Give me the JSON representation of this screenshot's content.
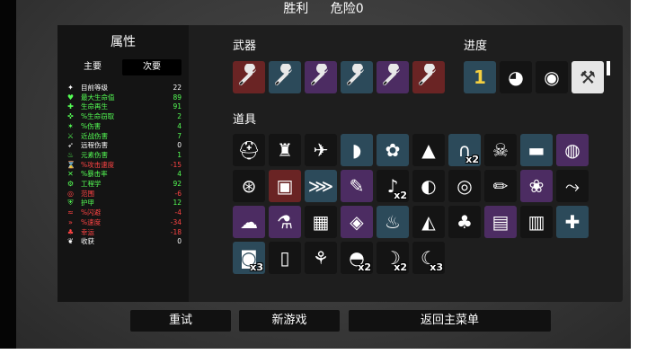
{
  "header": {
    "result": "胜利",
    "danger": "危险0"
  },
  "stats": {
    "title": "属性",
    "tab_primary": "主要",
    "tab_secondary": "次要",
    "rows": [
      {
        "icon": "level-icon",
        "glyph": "✦",
        "label": "目前等级",
        "value": "22",
        "color": "#ffffff"
      },
      {
        "icon": "max-hp-icon",
        "glyph": "♥",
        "label": "最大生命值",
        "value": "89",
        "color": "#55ff55"
      },
      {
        "icon": "hp-regen-icon",
        "glyph": "✚",
        "label": "生命再生",
        "value": "91",
        "color": "#55ff55"
      },
      {
        "icon": "life-steal-icon",
        "glyph": "✜",
        "label": "%生命窃取",
        "value": "2",
        "color": "#55ff55"
      },
      {
        "icon": "damage-icon",
        "glyph": "✶",
        "label": "%伤害",
        "value": "4",
        "color": "#55ff55"
      },
      {
        "icon": "melee-damage-icon",
        "glyph": "⚔",
        "label": "近战伤害",
        "value": "7",
        "color": "#55ff55"
      },
      {
        "icon": "ranged-damage-icon",
        "glyph": "➶",
        "label": "远程伤害",
        "value": "0",
        "color": "#ffffff"
      },
      {
        "icon": "elemental-damage-icon",
        "glyph": "♨",
        "label": "元素伤害",
        "value": "1",
        "color": "#55ff55"
      },
      {
        "icon": "attack-speed-icon",
        "glyph": "⌛",
        "label": "%攻击速度",
        "value": "-15",
        "color": "#ff4444"
      },
      {
        "icon": "crit-chance-icon",
        "glyph": "✕",
        "label": "%暴击率",
        "value": "4",
        "color": "#55ff55"
      },
      {
        "icon": "engineering-icon",
        "glyph": "⚙",
        "label": "工程学",
        "value": "92",
        "color": "#55ff55"
      },
      {
        "icon": "range-icon",
        "glyph": "◎",
        "label": "范围",
        "value": "-6",
        "color": "#ff4444"
      },
      {
        "icon": "armor-icon",
        "glyph": "⛨",
        "label": "护甲",
        "value": "12",
        "color": "#55ff55"
      },
      {
        "icon": "dodge-icon",
        "glyph": "≈",
        "label": "%闪避",
        "value": "-4",
        "color": "#ff4444"
      },
      {
        "icon": "speed-icon",
        "glyph": "»",
        "label": "%速度",
        "value": "-34",
        "color": "#ff4444"
      },
      {
        "icon": "luck-icon",
        "glyph": "♣",
        "label": "幸运",
        "value": "-18",
        "color": "#ff4444"
      },
      {
        "icon": "harvesting-icon",
        "glyph": "❦",
        "label": "收获",
        "value": "0",
        "color": "#ffffff"
      }
    ]
  },
  "weapons": {
    "label": "武器",
    "items": [
      {
        "icon": "wrench-icon",
        "tier": "red"
      },
      {
        "icon": "wrench-icon",
        "tier": "blue"
      },
      {
        "icon": "wrench-icon",
        "tier": "purple"
      },
      {
        "icon": "wrench-icon",
        "tier": "blue"
      },
      {
        "icon": "wrench-icon",
        "tier": "purple"
      },
      {
        "icon": "wrench-icon",
        "tier": "red"
      }
    ]
  },
  "progress": {
    "label": "进度",
    "items": [
      {
        "icon": "number-one-icon",
        "glyph": "1",
        "tier": "blue"
      },
      {
        "icon": "smug-egg-icon",
        "glyph": "◕",
        "tier": "normal"
      },
      {
        "icon": "masked-egg-icon",
        "glyph": "◉",
        "tier": "normal"
      },
      {
        "icon": "screwdriver-icon",
        "glyph": "⚒",
        "tier": "white"
      }
    ]
  },
  "items": {
    "label": "道具",
    "rows": [
      [
        {
          "icon": "helmet-icon",
          "glyph": "⛑",
          "tier": "normal",
          "count": ""
        },
        {
          "icon": "robot-icon",
          "glyph": "♜",
          "tier": "normal",
          "count": ""
        },
        {
          "icon": "tank-icon",
          "glyph": "✈",
          "tier": "normal",
          "count": ""
        },
        {
          "icon": "horn-icon",
          "glyph": "◗",
          "tier": "blue",
          "count": ""
        },
        {
          "icon": "bunny-icon",
          "glyph": "✿",
          "tier": "blue",
          "count": ""
        },
        {
          "icon": "witch-hat-icon",
          "glyph": "▲",
          "tier": "normal",
          "count": ""
        },
        {
          "icon": "magnet-icon",
          "glyph": "∩",
          "tier": "blue",
          "count": "x2"
        },
        {
          "icon": "skull-icon",
          "glyph": "☠",
          "tier": "normal",
          "count": ""
        },
        {
          "icon": "belt-icon",
          "glyph": "▬",
          "tier": "blue",
          "count": ""
        },
        {
          "icon": "snail-icon",
          "glyph": "◍",
          "tier": "purple",
          "count": ""
        }
      ],
      [
        {
          "icon": "turret-icon",
          "glyph": "⊛",
          "tier": "normal",
          "count": ""
        },
        {
          "icon": "treasure-chest-icon",
          "glyph": "▣",
          "tier": "red",
          "count": ""
        },
        {
          "icon": "claw-icon",
          "glyph": "⋙",
          "tier": "blue",
          "count": ""
        },
        {
          "icon": "scroll-icon",
          "glyph": "✎",
          "tier": "purple",
          "count": ""
        },
        {
          "icon": "cherry-icon",
          "glyph": "♪",
          "tier": "normal",
          "count": "x2"
        },
        {
          "icon": "armor-plate-icon",
          "glyph": "◐",
          "tier": "normal",
          "count": ""
        },
        {
          "icon": "target-dummy-icon",
          "glyph": "◎",
          "tier": "normal",
          "count": ""
        },
        {
          "icon": "pencil-icon",
          "glyph": "✏",
          "tier": "normal",
          "count": ""
        },
        {
          "icon": "brain-icon",
          "glyph": "❀",
          "tier": "purple",
          "count": ""
        },
        {
          "icon": "branch-icon",
          "glyph": "⤳",
          "tier": "normal",
          "count": ""
        }
      ],
      [
        {
          "icon": "ghost-icon",
          "glyph": "☁",
          "tier": "purple",
          "count": ""
        },
        {
          "icon": "potion-icon",
          "glyph": "⚗",
          "tier": "purple",
          "count": ""
        },
        {
          "icon": "wicker-icon",
          "glyph": "▦",
          "tier": "normal",
          "count": ""
        },
        {
          "icon": "bandage-icon",
          "glyph": "◈",
          "tier": "purple",
          "count": ""
        },
        {
          "icon": "campfire-icon",
          "glyph": "♨",
          "tier": "blue",
          "count": ""
        },
        {
          "icon": "bullet-icon",
          "glyph": "◭",
          "tier": "normal",
          "count": ""
        },
        {
          "icon": "tree-icon",
          "glyph": "♣",
          "tier": "normal",
          "count": ""
        },
        {
          "icon": "toolbox-icon",
          "glyph": "▤",
          "tier": "purple",
          "count": ""
        },
        {
          "icon": "workbench-icon",
          "glyph": "▥",
          "tier": "normal",
          "count": ""
        },
        {
          "icon": "medic-robot-icon",
          "glyph": "✚",
          "tier": "blue",
          "count": ""
        }
      ],
      [
        {
          "icon": "visor-helmet-icon",
          "glyph": "◙",
          "tier": "blue",
          "count": "x3"
        },
        {
          "icon": "book-icon",
          "glyph": "▯",
          "tier": "normal",
          "count": ""
        },
        {
          "icon": "sprout-icon",
          "glyph": "⚘",
          "tier": "normal",
          "count": ""
        },
        {
          "icon": "dome-helmet-icon",
          "glyph": "◓",
          "tier": "normal",
          "count": "x2"
        },
        {
          "icon": "scythe-icon",
          "glyph": "☽",
          "tier": "normal",
          "count": "x2"
        },
        {
          "icon": "crescent-icon",
          "glyph": "☾",
          "tier": "normal",
          "count": "x3"
        }
      ]
    ]
  },
  "buttons": {
    "retry": "重试",
    "new_game": "新游戏",
    "main_menu": "返回主菜单"
  }
}
